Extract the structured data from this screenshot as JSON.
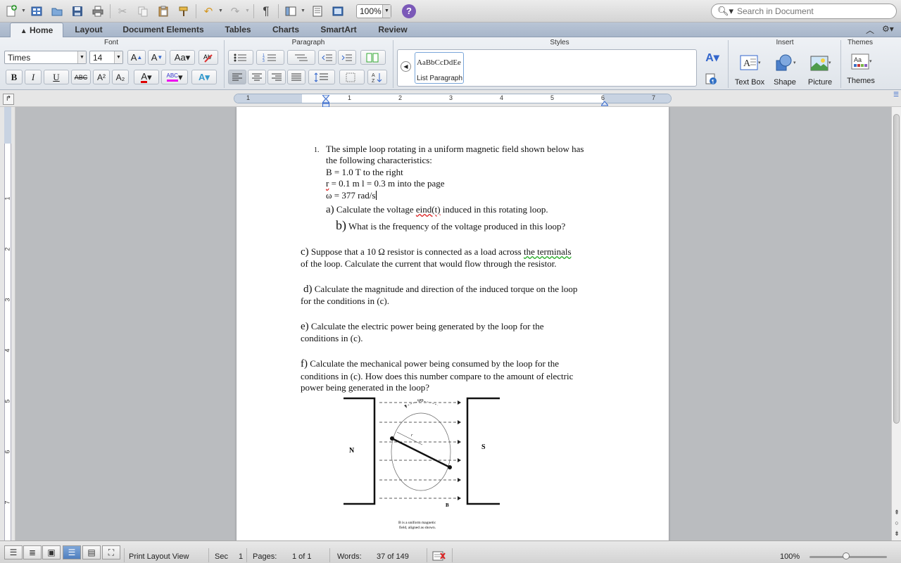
{
  "toolbar": {
    "zoom": "100%",
    "search_placeholder": "Search in Document",
    "help": "?"
  },
  "ribbon_tabs": {
    "items": [
      "Home",
      "Layout",
      "Document Elements",
      "Tables",
      "Charts",
      "SmartArt",
      "Review"
    ],
    "active": "Home"
  },
  "ribbon": {
    "groups": {
      "font": "Font",
      "paragraph": "Paragraph",
      "styles": "Styles",
      "insert": "Insert",
      "themes": "Themes"
    },
    "font_name": "Times",
    "font_size": "14",
    "style_sample": "AaBbCcDdEe",
    "style_name": "List Paragraph",
    "insert_items": [
      "Text Box",
      "Shape",
      "Picture"
    ],
    "themes_label": "Themes",
    "format_buttons": {
      "bold": "B",
      "italic": "I",
      "underline": "U",
      "strike": "ABC",
      "superscript": "A²",
      "subscript": "A₂"
    }
  },
  "ruler": {
    "numbers": [
      "1",
      "1",
      "2",
      "3",
      "4",
      "5",
      "6",
      "7"
    ]
  },
  "vruler": {
    "numbers": [
      "1",
      "2",
      "3",
      "4",
      "5",
      "6",
      "7"
    ]
  },
  "document": {
    "item_number": "1.",
    "q_line1": "The simple loop rotating in a uniform magnetic field shown below has",
    "q_line2": "the following characteristics:",
    "q_line3": "B = 1.0 T to the right",
    "q_line4_r": "r",
    "q_line4_rest": " = 0.1 m l = 0.3 m into the page",
    "q_line5": "ω = 377 rad/s",
    "a_label": "a)",
    "a_pre": " Calculate the voltage ",
    "a_sq": "eind(t)",
    "a_post": " induced in this rotating loop.",
    "b_label": "b)",
    "b_text": " What is the frequency of the voltage produced in this loop?",
    "c_label": "c)",
    "c_pre": " Suppose that a 10 Ω resistor is connected as a load across ",
    "c_sq": "the  terminals",
    "c_line2": "of the loop. Calculate the current that would flow through the resistor.",
    "d_label": "d)",
    "d_text": " Calculate the magnitude and direction of the induced torque on the loop",
    "d_line2": "for the conditions in (c).",
    "e_label": "e)",
    "e_text": " Calculate the electric power being generated by the loop for the",
    "e_line2": "conditions in (c).",
    "f_label": "f)",
    "f_text": " Calculate the mechanical power being consumed by the loop for the",
    "f_line2": "conditions in (c). How does this number compare to the amount of electric",
    "f_line3": "power being generated in the loop?",
    "figure": {
      "pole_n": "N",
      "pole_s": "S",
      "b_label": "B",
      "r_label": "r",
      "omega_label": "ωm",
      "caption1": "B is a uniform magnetic",
      "caption2": "field, aligned as shown."
    }
  },
  "statusbar": {
    "view": "Print Layout View",
    "sec_label": "Sec",
    "sec_value": "1",
    "pages_label": "Pages:",
    "pages_value": "1 of 1",
    "words_label": "Words:",
    "words_value": "37 of 149",
    "zoom": "100%"
  }
}
